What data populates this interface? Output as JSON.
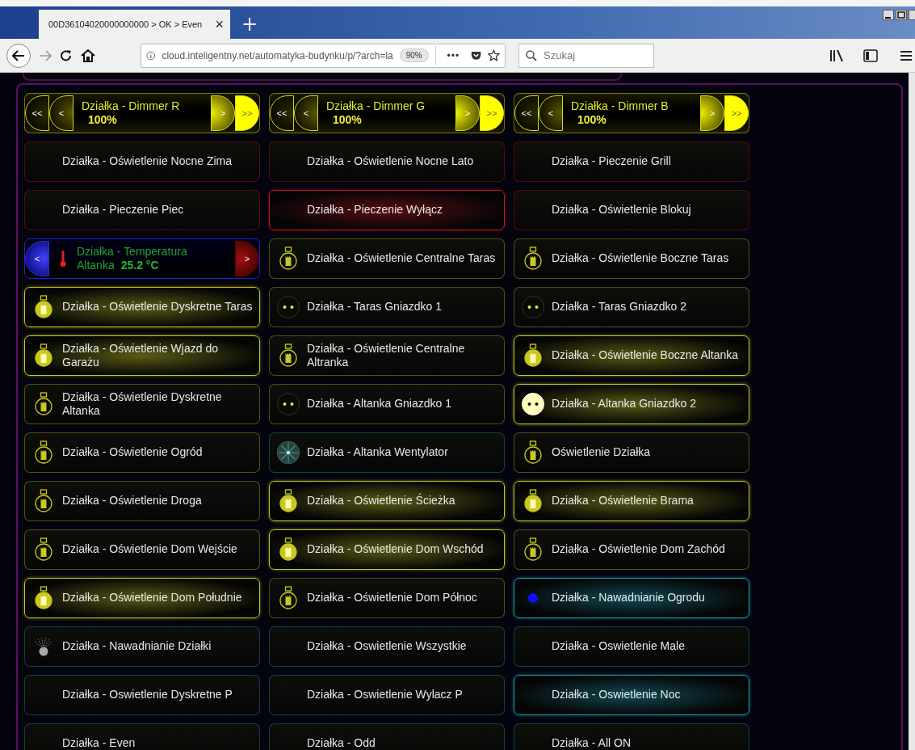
{
  "browser": {
    "tab": {
      "title": "00D36104020000000000 > OK > Even",
      "close": "×"
    },
    "new_tab": "+",
    "url": "cloud.inteligentny.net/automatyka-budynku/p/?arch=la",
    "zoom": "90%",
    "more": "•••",
    "search": {
      "placeholder": "Szukaj"
    }
  },
  "tiles": [
    {
      "kind": "dimmer",
      "title": "Działka - Dimmer R",
      "value": "100%",
      "buttons": [
        "<<",
        "<",
        ">",
        ">>"
      ]
    },
    {
      "kind": "dimmer",
      "title": "Działka - Dimmer G",
      "value": "100%",
      "buttons": [
        "<<",
        "<",
        ">",
        ">>"
      ]
    },
    {
      "kind": "dimmer",
      "title": "Działka - Dimmer B",
      "value": "100%",
      "buttons": [
        "<<",
        "<",
        ">",
        ">>"
      ]
    },
    {
      "kind": "scene",
      "label": "Działka - Oświetlenie Nocne Zima",
      "on": false
    },
    {
      "kind": "scene",
      "label": "Działka - Oświetlenie Nocne Lato",
      "on": false
    },
    {
      "kind": "scene",
      "label": "Działka - Pieczenie Grill",
      "on": false
    },
    {
      "kind": "scene",
      "label": "Działka - Pieczenie Piec",
      "on": false
    },
    {
      "kind": "scene",
      "label": "Działka - Pieczenie Wyłącz",
      "on": true
    },
    {
      "kind": "scene",
      "label": "Działka - Oświetlenie Blokuj",
      "on": false
    },
    {
      "kind": "temperature",
      "title": "Działka - Temperatura",
      "place": "Altanka",
      "value": "25.2 °C",
      "buttons": [
        "<",
        ">"
      ]
    },
    {
      "kind": "light",
      "label": "Działka - Oświetlenie Centralne Taras",
      "on": false
    },
    {
      "kind": "light",
      "label": "Działka - Oświetlenie Boczne Taras",
      "on": false
    },
    {
      "kind": "light",
      "label": "Działka - Oświetlenie Dyskretne Taras",
      "on": true
    },
    {
      "kind": "socket",
      "label": "Działka - Taras Gniazdko 1",
      "on": false
    },
    {
      "kind": "socket",
      "label": "Działka - Taras Gniazdko 2",
      "on": false
    },
    {
      "kind": "light",
      "label": "Działka - Oświetlenie Wjazd do Garażu",
      "on": true
    },
    {
      "kind": "light",
      "label": "Działka - Oświetlenie Centralne Altranka",
      "on": false
    },
    {
      "kind": "light",
      "label": "Działka - Oświetlenie Boczne Altanka",
      "on": true
    },
    {
      "kind": "light",
      "label": "Działka - Oświetlenie Dyskretne Altanka",
      "on": false
    },
    {
      "kind": "socket",
      "label": "Działka - Altanka Gniazdko 1",
      "on": false
    },
    {
      "kind": "socket",
      "label": "Działka - Altanka Gniazdko 2",
      "on": true
    },
    {
      "kind": "light",
      "label": "Działka - Oświetlenie Ogród",
      "on": false
    },
    {
      "kind": "fan",
      "label": "Działka - Altanka Wentylator",
      "on": false
    },
    {
      "kind": "light",
      "label": "Oświetlenie Działka",
      "on": false
    },
    {
      "kind": "light",
      "label": "Działka - Oświetlenie Droga",
      "on": false
    },
    {
      "kind": "light",
      "label": "Działka - Oświetlenie Ścieżka",
      "on": true
    },
    {
      "kind": "light",
      "label": "Działka - Oświetlenie Brama",
      "on": true
    },
    {
      "kind": "light",
      "label": "Działka - Oświetlenie Dom Wejście",
      "on": false
    },
    {
      "kind": "light",
      "label": "Działka - Oświetlenie Dom Wschód",
      "on": true
    },
    {
      "kind": "light",
      "label": "Działka - Oświetlenie Dom Zachód",
      "on": false
    },
    {
      "kind": "light",
      "label": "Działka - Oświetlenie Dom Południe",
      "on": true
    },
    {
      "kind": "light",
      "label": "Działka - Oświetlenie Dom Północ",
      "on": false
    },
    {
      "kind": "valve",
      "label": "Działka - Nawadnianie Ogrodu",
      "on": true
    },
    {
      "kind": "sprinkler",
      "label": "Działka - Nawadnianie Działki",
      "on": false
    },
    {
      "kind": "macro",
      "label": "Działka - Oswietlenie Wszystkie",
      "on": false
    },
    {
      "kind": "macro",
      "label": "Działka - Oswietlenie Male",
      "on": false
    },
    {
      "kind": "macro",
      "label": "Działka - Oswietlenie Dyskretne P",
      "on": false
    },
    {
      "kind": "macro",
      "label": "Działka - Oswietlenie Wylacz P",
      "on": false
    },
    {
      "kind": "macro",
      "label": "Działka - Oswietlenie Noc",
      "on": true
    },
    {
      "kind": "macro",
      "label": "Działka - Even",
      "on": false
    },
    {
      "kind": "macro",
      "label": "Działka - Odd",
      "on": false
    },
    {
      "kind": "macro",
      "label": "Działka - All ON",
      "on": false
    }
  ]
}
